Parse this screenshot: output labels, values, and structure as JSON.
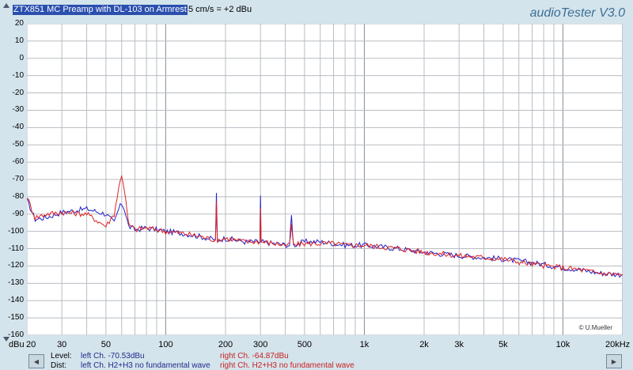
{
  "app_title": "audioTester  V3.0",
  "measurement": {
    "title_selected": "ZTX851 MC Preamp with DL-103 on Armrest",
    "title_rest": "5 cm/s = +2 dBu"
  },
  "copyright": "© U.Mueller",
  "info": {
    "level_label": "Level:",
    "dist_label": "Dist:",
    "left_level": "left Ch. -70.53dBu",
    "right_level": "right Ch. -64.87dBu",
    "left_dist": "left Ch. H2+H3 no fundamental wave",
    "right_dist": "right Ch. H2+H3 no fundamental wave"
  },
  "colors": {
    "left": "#2020c8",
    "right": "#e02020",
    "background": "#d4e4ec",
    "plot_bg": "#ffffff",
    "grid": "#9aa0a6"
  },
  "chart_data": {
    "type": "line",
    "xlabel": "dBu",
    "x_scale": "log",
    "xlim": [
      20,
      20000
    ],
    "ylim": [
      -160,
      20
    ],
    "yticks": [
      20,
      10,
      0,
      -10,
      -20,
      -30,
      -40,
      -50,
      -60,
      -70,
      -80,
      -90,
      -100,
      -110,
      -120,
      -130,
      -140,
      -150,
      -160
    ],
    "xticks": [
      "20",
      "30",
      "50",
      "100",
      "200",
      "300",
      "500",
      "1k",
      "2k",
      "3k",
      "5k",
      "10k",
      "20kHz"
    ],
    "grid": true,
    "series": [
      {
        "color": "#2020c8",
        "x": [
          20,
          22,
          25,
          30,
          40,
          50,
          55,
          58,
          60,
          62,
          65,
          70,
          80,
          100,
          120,
          150,
          178,
          180,
          182,
          200,
          250,
          298,
          300,
          302,
          350,
          420,
          430,
          440,
          500,
          600,
          700,
          800,
          1000,
          1500,
          2000,
          3000,
          5000,
          7000,
          10000,
          12000,
          15000,
          20000
        ],
        "y": [
          -82,
          -93,
          -92,
          -89,
          -87,
          -90,
          -95,
          -87,
          -84,
          -87,
          -97,
          -99,
          -98,
          -100,
          -101,
          -103,
          -105,
          -79,
          -105,
          -104,
          -106,
          -106,
          -80,
          -106,
          -107,
          -108,
          -91,
          -108,
          -106,
          -106,
          -107,
          -108,
          -108,
          -110,
          -112,
          -114,
          -116,
          -118,
          -121,
          -122,
          -124,
          -125
        ]
      },
      {
        "color": "#e02020",
        "x": [
          20,
          22,
          25,
          30,
          40,
          50,
          55,
          58,
          60,
          62,
          65,
          70,
          80,
          100,
          120,
          150,
          178,
          180,
          182,
          200,
          250,
          298,
          300,
          302,
          350,
          420,
          430,
          440,
          500,
          600,
          700,
          800,
          1000,
          1500,
          2000,
          3000,
          5000,
          7000,
          10000,
          12000,
          15000,
          20000
        ],
        "y": [
          -80,
          -92,
          -90,
          -89,
          -90,
          -97,
          -90,
          -75,
          -67,
          -76,
          -96,
          -99,
          -98,
          -100,
          -101,
          -103,
          -105,
          -84,
          -105,
          -104,
          -106,
          -106,
          -85,
          -106,
          -107,
          -108,
          -97,
          -108,
          -107,
          -107,
          -107,
          -108,
          -108,
          -110,
          -112,
          -114,
          -116,
          -119,
          -121,
          -122,
          -124,
          -125
        ]
      }
    ]
  }
}
